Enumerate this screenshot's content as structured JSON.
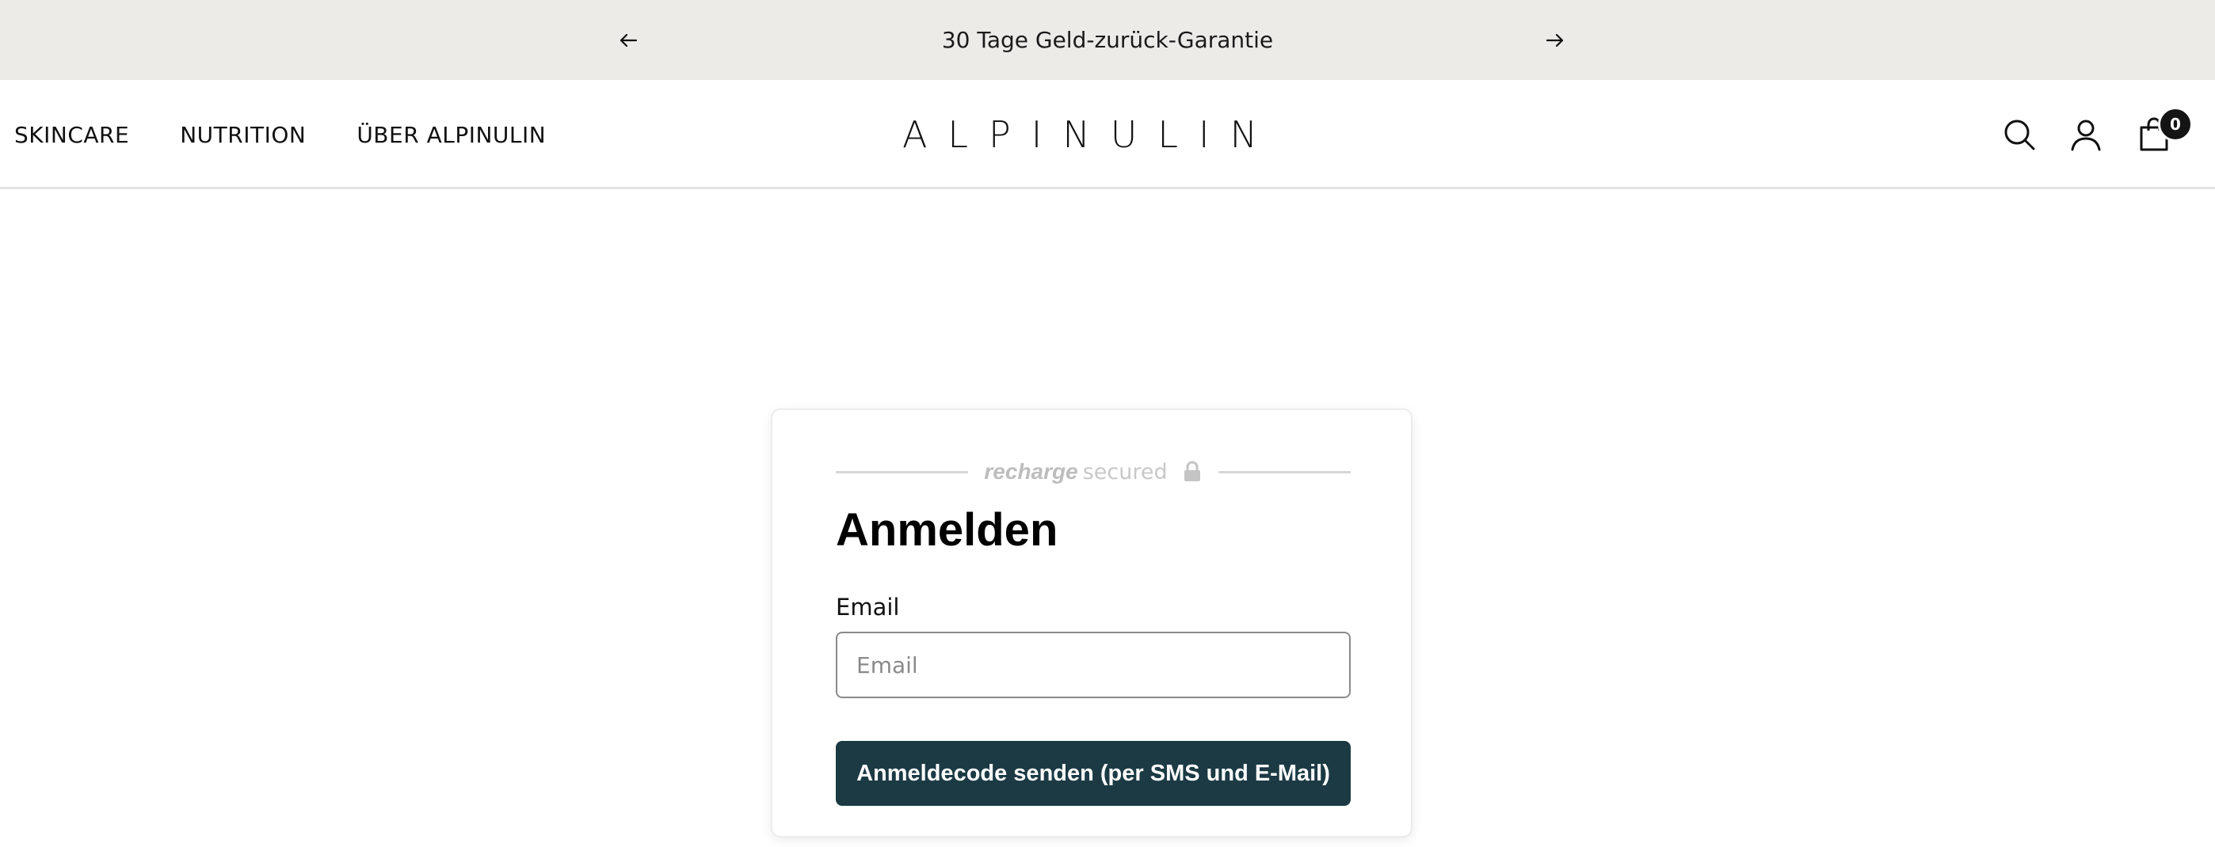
{
  "announcement": {
    "message": "30 Tage Geld-zurück-Garantie",
    "prev_icon": "arrow-left-icon",
    "next_icon": "arrow-right-icon"
  },
  "header": {
    "nav": [
      {
        "label": "SKINCARE"
      },
      {
        "label": "NUTRITION"
      },
      {
        "label": "ÜBER ALPINULIN"
      }
    ],
    "logo_text": "ALPINULIN",
    "icons": [
      "search-icon",
      "account-icon",
      "cart-icon"
    ],
    "cart_count": "0"
  },
  "login": {
    "secured_brand": "recharge",
    "secured_word": "secured",
    "title": "Anmelden",
    "email_label": "Email",
    "email_placeholder": "Email",
    "email_value": "",
    "submit_label": "Anmeldecode senden (per SMS und E-Mail)"
  },
  "colors": {
    "announcement_bg": "#ecebe8",
    "button_bg": "#1b3a44",
    "badge_bg": "#141414"
  }
}
